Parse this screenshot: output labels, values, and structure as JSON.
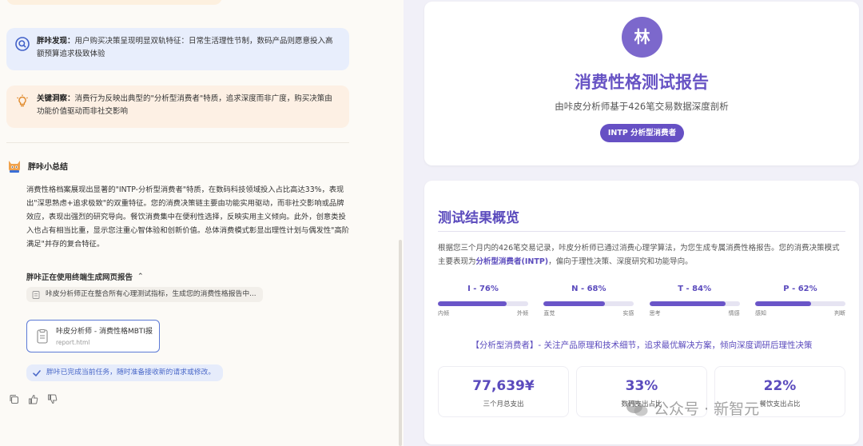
{
  "chat": {
    "discovery": {
      "label": "胖咔发现：",
      "text": "用户购买决策呈现明显双轨特征：日常生活理性节制，数码产品则愿意投入高额预算追求极致体验"
    },
    "insight": {
      "label": "关键洞察：",
      "text": "消费行为反映出典型的\"分析型消费者\"特质，追求深度而非广度，购买决策由功能价值驱动而非社交影响"
    },
    "summary_title": "胖咔小总结",
    "summary_body": "消费性格档案展现出显著的\"INTP-分析型消费者\"特质，在数码科技领域投入占比高达33%，表现出\"深思熟虑+追求极致\"的双重特征。您的消费决策链主要由功能实用驱动，而非社交影响或品牌效应，表现出强烈的研究导向。餐饮消费集中在便利性选择，反映实用主义倾向。此外，创意类投入也占有相当比重，显示您注重心智体验和创新价值。总体消费模式彰显出理性计划与偶发性\"高阶满足\"并存的复合特征。",
    "tool_title": "胖咔正在使用终端生成网页报告",
    "tool_status": "咔皮分析师正在整合所有心理测试指标，生成您的消费性格报告中...",
    "file_name": "咔皮分析师 - 消费性格MBTI报告",
    "file_path": "report.html",
    "done_text": "胖咔已完成当前任务，随时准备接收新的请求或修改。",
    "icons": [
      "copy-icon",
      "thumbs-up-icon",
      "thumbs-down-icon"
    ]
  },
  "report": {
    "avatar_char": "林",
    "title": "消费性格测试报告",
    "subtitle": "由咔皮分析师基于426笔交易数据深度剖析",
    "badge": "INTP 分析型消费者",
    "section_title": "测试结果概览",
    "desc_prefix": "根据您三个月内的426笔交易记录，咔皮分析师已通过消费心理学算法，为您生成专属消费性格报告。您的消费决策模式主要表现为",
    "desc_highlight": "分析型消费者(INTP)",
    "desc_suffix": "，偏向于理性决策、深度研究和功能导向。",
    "dimensions": [
      {
        "label": "I - 76%",
        "value": 0.76,
        "left": "内倾",
        "right": "外倾"
      },
      {
        "label": "N - 68%",
        "value": 0.68,
        "left": "直觉",
        "right": "实感"
      },
      {
        "label": "T - 84%",
        "value": 0.84,
        "left": "思考",
        "right": "情感"
      },
      {
        "label": "P - 62%",
        "value": 0.62,
        "left": "感知",
        "right": "判断"
      }
    ],
    "type_line": "【分析型消费者】- 关注产品原理和技术细节，追求最优解决方案，倾向深度调研后理性决策",
    "stats": [
      {
        "value": "77,639¥",
        "label": "三个月总支出"
      },
      {
        "value": "33%",
        "label": "数码支出占比"
      },
      {
        "value": "22%",
        "label": "餐饮支出占比"
      }
    ]
  },
  "watermark": "公众号 · 新智元",
  "colors": {
    "accent": "#6753c4",
    "blue_chip": "#4a68c8"
  }
}
